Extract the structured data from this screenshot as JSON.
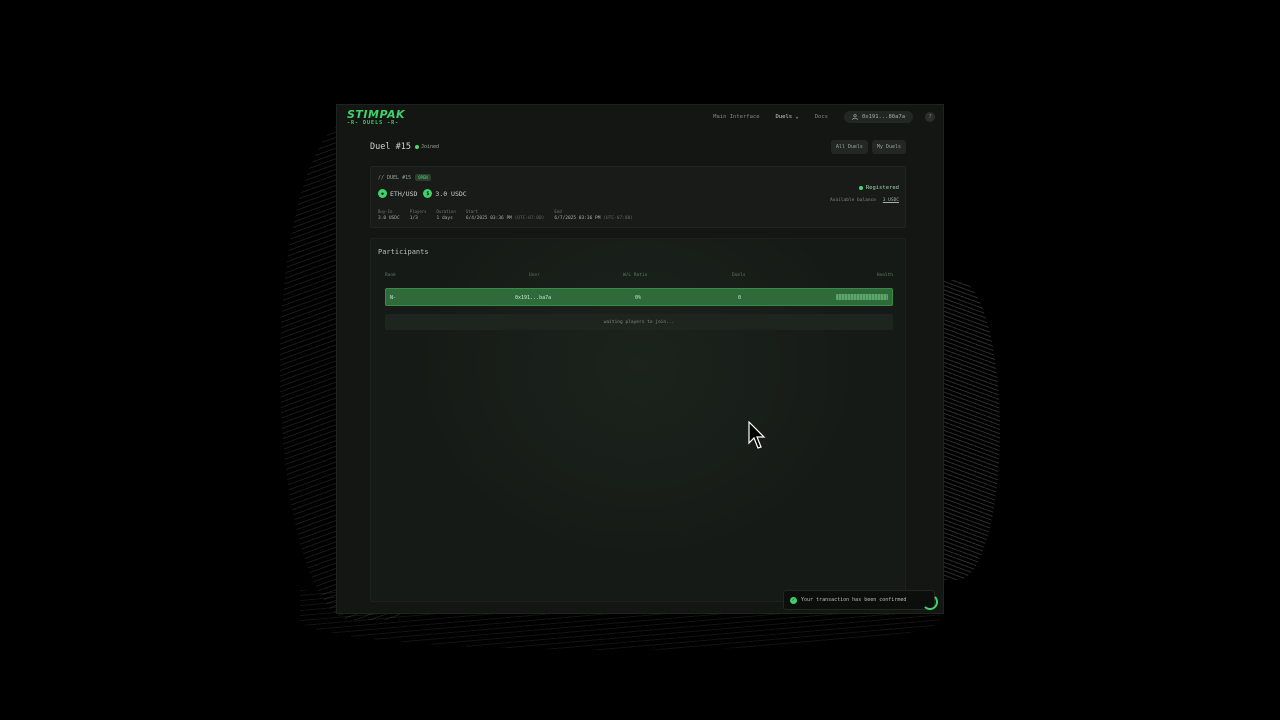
{
  "nav": {
    "logo_main": "STIMPAK",
    "logo_sub": "-R- DUELS -R-",
    "links": [
      "Main Interface",
      "Duels",
      "Docs"
    ],
    "wallet": "0x191...80a7a",
    "help": "?"
  },
  "header": {
    "title": "Duel #15",
    "status": "Joined",
    "buttons": [
      "All Duels",
      "My Duels"
    ]
  },
  "card": {
    "label": "// DUEL #15",
    "badge": "OPEN",
    "asset": "ETH/USD",
    "stake": "3.0 USDC",
    "stats": [
      {
        "label": "Buy-In",
        "value": "3.0 USDC"
      },
      {
        "label": "Players",
        "value": "1/3"
      },
      {
        "label": "Duration",
        "value": "1 days"
      },
      {
        "label": "Start",
        "value": "6/4/2025 03:36 PM",
        "tz": "(UTC-07:00)"
      },
      {
        "label": "End",
        "value": "6/7/2025 03:36 PM",
        "tz": "(UTC-07:00)"
      }
    ],
    "registered": "Registered",
    "balance_label": "Available balance",
    "balance_value": "3 USDC"
  },
  "participants": {
    "title": "Participants",
    "columns": [
      "Rank",
      "User",
      "W/L Ratio",
      "Duels",
      "Health"
    ],
    "rows": [
      {
        "rank": "N-",
        "user": "0x191...ba7a",
        "ratio": "0%",
        "duels": "0",
        "health": 1.0
      }
    ],
    "waiting": "waiting players to join..."
  },
  "toast": {
    "message": "Your transaction has been confirmed"
  },
  "colors": {
    "accent": "#3fd16a",
    "row_bg": "#2f6b3a"
  }
}
